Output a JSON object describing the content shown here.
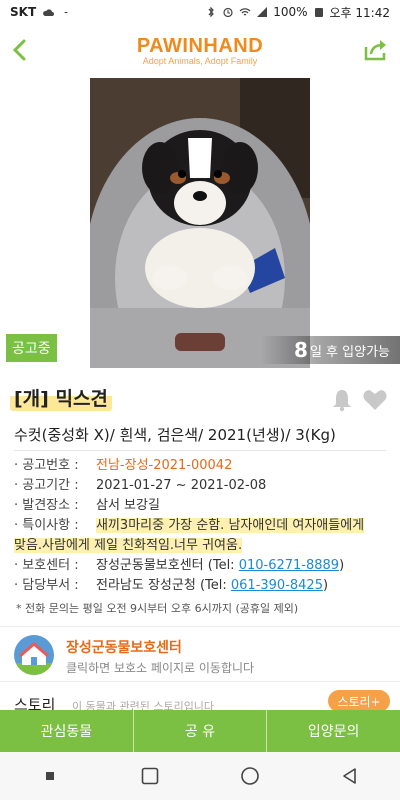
{
  "status_bar": {
    "carrier": "SKT",
    "battery": "100%",
    "time": "오후 11:42"
  },
  "header": {
    "logo_title": "PAWINHAND",
    "logo_subtitle": "Adopt Animals, Adopt Family",
    "back_icon": "chevron-left-icon",
    "share_icon": "share-icon",
    "accent_color": "#7bc043",
    "brand_color": "#f08a1c"
  },
  "photo": {
    "status_badge": "공고중",
    "adopt_days": "8",
    "adopt_suffix": "일 후 입양가능"
  },
  "animal": {
    "title": "[개] 믹스견",
    "summary": "수컷(중성화 X)/ 흰색, 검은색/ 2021(년생)/ 3(Kg)"
  },
  "info": {
    "notice_no_label": "· 공고번호 :",
    "notice_no": "전남-장성-2021-00042",
    "period_label": "· 공고기간 :",
    "period": "2021-01-27 ~ 2021-02-08",
    "found_label": "· 발견장소 :",
    "found": "삼서 보강길",
    "special_label": "· 특이사항 :",
    "special_line1": "새끼3마리중 가장 순함. 남자애인데 여자애들에게",
    "special_line2": "맞음.사람에게 제일 친화적임.너무 귀여움.",
    "center_label": "· 보호센터 :",
    "center_name": "장성군동물보호센터 (Tel: ",
    "center_tel": "010-6271-8889",
    "center_close": ")",
    "dept_label": "· 담당부서 :",
    "dept_name": "전라남도 장성군청 (Tel: ",
    "dept_tel": "061-390-8425",
    "dept_close": ")",
    "note": "* 전화 문의는 평일 오전 9시부터 오후 6시까지 (공휴일 제외)"
  },
  "shelter": {
    "name": "장성군동물보호센터",
    "sub": "클릭하면 보호소 페이지로 이동합니다"
  },
  "story": {
    "label": "스토리",
    "sub": "이 동물과 관련된 스토리입니다",
    "button": "스토리+"
  },
  "bottom_bar": {
    "interest": "관심동물",
    "share": "공 유",
    "inquiry": "입양문의"
  }
}
